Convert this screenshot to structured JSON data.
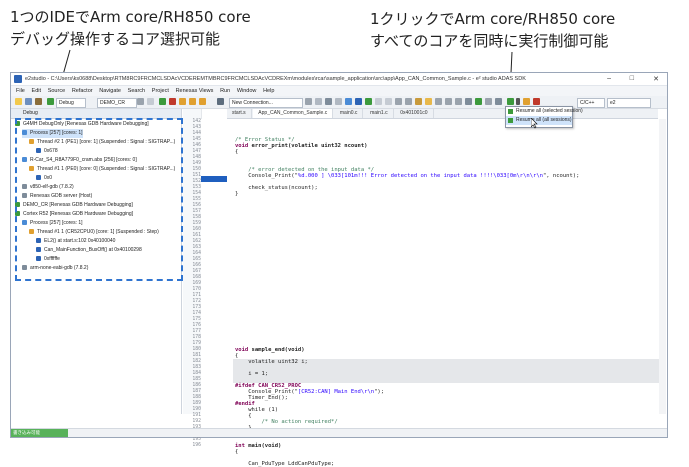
{
  "annotations": {
    "left_line1": "1つのIDEでArm core/RH850 core",
    "left_line2": "デバッグ操作するコア選択可能",
    "right_line1": "1クリックでArm core/RH850 core",
    "right_line2": "すべてのコアを同時に実行制御可能"
  },
  "window": {
    "title": "e2studio - C:\\Users\\ks0688\\Desktop\\RTM8RC9FRCMCLSDAcVCDEREMTMBRC9FRCMCLSDAcVCDREXm\\modules\\rcar\\sample_application\\src\\app\\App_CAN_Common_Sample.c - e² studio ADAS SDK",
    "minimize": "–",
    "maximize": "□",
    "close": "✕"
  },
  "menu": [
    "File",
    "Edit",
    "Source",
    "Refactor",
    "Navigate",
    "Search",
    "Project",
    "Renesas Views",
    "Run",
    "Window",
    "Help"
  ],
  "toolbar": {
    "debug_button": "Debug",
    "launch_config": "DEMO_CR",
    "connection": "New Connection...",
    "resume_tooltip": "Resume all",
    "right_field": "C/C++",
    "quick_access": "e2"
  },
  "resume_menu": [
    {
      "label": "Resume all (selected session)",
      "selected": false
    },
    {
      "label": "Resume all (all sessions)",
      "selected": true
    }
  ],
  "debug_view": {
    "tab_label": "Debug",
    "rows": [
      {
        "text": "G4MH DebugOnly [Renesas GDB Hardware Debugging]",
        "indent": 0,
        "icon": "launch-icon"
      },
      {
        "text": "Process [257] [cores: 1]",
        "indent": 1,
        "icon": "process-icon"
      },
      {
        "text": "Thread #2 1 (PE1) [core: 1] (Suspended : Signal : SIGTRAP...)",
        "indent": 2,
        "icon": "thread-icon"
      },
      {
        "text": "0x678",
        "indent": 3,
        "icon": "frame-icon"
      },
      {
        "text": "R-Car_S4_R8A779F0_cram.abs [256] [cores: 0]",
        "indent": 1,
        "icon": "process-icon"
      },
      {
        "text": "Thread #1 1 (PE0) [core: 0] (Suspended : Signal : SIGTRAP...)",
        "indent": 2,
        "icon": "thread-icon"
      },
      {
        "text": "0x0",
        "indent": 3,
        "icon": "frame-icon"
      },
      {
        "text": "v850-elf-gdb (7.8.2)",
        "indent": 1,
        "icon": "gdb-icon"
      },
      {
        "text": "Renesas GDB server (Host)",
        "indent": 1,
        "icon": "server-icon"
      },
      {
        "text": "DEMO_CR [Renesas GDB Hardware Debugging]",
        "indent": 0,
        "icon": "launch-icon"
      },
      {
        "text": "Cortex R52 [Renesas GDB Hardware Debugging]",
        "indent": 0,
        "icon": "launch-icon"
      },
      {
        "text": "Process [257] [cores: 1]",
        "indent": 1,
        "icon": "process-icon"
      },
      {
        "text": "Thread #1 1 (CR52CPU0) [core: 1] (Suspended : Step)",
        "indent": 2,
        "icon": "thread-icon"
      },
      {
        "text": "EL2() at start.s:102 0x40100040",
        "indent": 3,
        "icon": "frame-icon"
      },
      {
        "text": "Can_MainFunction_BusOff() at 0x40100298",
        "indent": 3,
        "icon": "frame-icon"
      },
      {
        "text": "0xffffffe",
        "indent": 3,
        "icon": "frame-icon"
      },
      {
        "text": "arm-none-eabi-gdb (7.8.2)",
        "indent": 1,
        "icon": "gdb-icon"
      }
    ]
  },
  "editor_tabs": [
    "start.s",
    "App_CAN_Common_Sample.c",
    "main0.c",
    "main1.c",
    "0x401001c0"
  ],
  "line_numbers": [
    "142",
    "143",
    "144",
    "145",
    "146",
    "147",
    "148",
    "149",
    "150",
    "151",
    "152",
    "153",
    "154",
    "155",
    "156",
    "157",
    "158",
    "159",
    "160",
    "161",
    "162",
    "163",
    "164",
    "165",
    "166",
    "167",
    "168",
    "169",
    "170",
    "171",
    "172",
    "173",
    "174",
    "175",
    "176",
    "177",
    "178",
    "179",
    "180",
    "181",
    "182",
    "183",
    "184",
    "185",
    "186",
    "187",
    "188",
    "189",
    "190",
    "191",
    "192",
    "193",
    "194",
    "195",
    "196"
  ],
  "code": {
    "l145": "/* Error Status */",
    "l146_kw": "void",
    "l146": " error_print(volatile uint32 ncount)",
    "l147": "{",
    "l150": "    /* error detected on the input data */",
    "l151a": "    Console_Print(\"",
    "l151b": "%d.000 ] \\033[101m!!! Error detected on the input data !!!!\\033[0m\\r\\n\\r\\n",
    "l151c": "\", ncount);",
    "l153": "    check_status(ncount);",
    "l154": "}",
    "l180_kw": "void",
    "l180": " sample_end(void)",
    "l181": "{",
    "l182": "    volatile uint32 i;",
    "l184": "    i = 1;",
    "l186": "#ifdef CAN_CR52_PROC",
    "l187a": "    Console_Print(\"",
    "l187b": "[CR52:CAN] Main End\\r\\n",
    "l187c": "\");",
    "l188": "    Timer_End();",
    "l189": "#endif",
    "l190": "    while (1)",
    "l191": "    {",
    "l192": "        /* No action required*/",
    "l193": "    }",
    "l194": "}",
    "l196_kw": "int",
    "l196": " main(void)",
    "l197": "{",
    "l199": "    Can_PduType LddCanPduType;"
  },
  "status": {
    "left": "書き込み可能"
  }
}
